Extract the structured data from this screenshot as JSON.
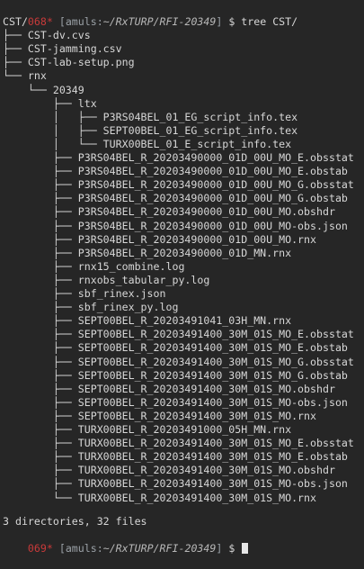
{
  "colors": {
    "background": "#262626",
    "text": "#d7d7d7",
    "prompt_red": "#c83a3a",
    "prompt_gray": "#9aa0a6"
  },
  "command_prompt": {
    "exit_code": "0",
    "counter": "68*",
    "user_host": "amuls",
    "path": "~/RxTURP/RFI-20349",
    "symbol": "$",
    "command": "tree CST/"
  },
  "tree_lines": [
    "CST/",
    "├── CST-dv.cvs",
    "├── CST-jamming.csv",
    "├── CST-lab-setup.png",
    "└── rnx",
    "    └── 20349",
    "        ├── ltx",
    "        │   ├── P3RS04BEL_01_EG_script_info.tex",
    "        │   ├── SEPT00BEL_01_EG_script_info.tex",
    "        │   └── TURX00BEL_01_E_script_info.tex",
    "        ├── P3RS04BEL_R_20203490000_01D_00U_MO_E.obsstat",
    "        ├── P3RS04BEL_R_20203490000_01D_00U_MO_E.obstab",
    "        ├── P3RS04BEL_R_20203490000_01D_00U_MO_G.obsstat",
    "        ├── P3RS04BEL_R_20203490000_01D_00U_MO_G.obstab",
    "        ├── P3RS04BEL_R_20203490000_01D_00U_MO.obshdr",
    "        ├── P3RS04BEL_R_20203490000_01D_00U_MO-obs.json",
    "        ├── P3RS04BEL_R_20203490000_01D_00U_MO.rnx",
    "        ├── P3RS04BEL_R_20203490000_01D_MN.rnx",
    "        ├── rnx15_combine.log",
    "        ├── rnxobs_tabular_py.log",
    "        ├── sbf_rinex.json",
    "        ├── sbf_rinex_py.log",
    "        ├── SEPT00BEL_R_20203491041_03H_MN.rnx",
    "        ├── SEPT00BEL_R_20203491400_30M_01S_MO_E.obsstat",
    "        ├── SEPT00BEL_R_20203491400_30M_01S_MO_E.obstab",
    "        ├── SEPT00BEL_R_20203491400_30M_01S_MO_G.obsstat",
    "        ├── SEPT00BEL_R_20203491400_30M_01S_MO_G.obstab",
    "        ├── SEPT00BEL_R_20203491400_30M_01S_MO.obshdr",
    "        ├── SEPT00BEL_R_20203491400_30M_01S_MO-obs.json",
    "        ├── SEPT00BEL_R_20203491400_30M_01S_MO.rnx",
    "        ├── TURX00BEL_R_20203491000_05H_MN.rnx",
    "        ├── TURX00BEL_R_20203491400_30M_01S_MO_E.obsstat",
    "        ├── TURX00BEL_R_20203491400_30M_01S_MO_E.obstab",
    "        ├── TURX00BEL_R_20203491400_30M_01S_MO.obshdr",
    "        ├── TURX00BEL_R_20203491400_30M_01S_MO-obs.json",
    "        └── TURX00BEL_R_20203491400_30M_01S_MO.rnx"
  ],
  "blank_line": "",
  "summary": "3 directories, 32 files",
  "next_prompt": {
    "exit_code": "0",
    "counter": "69*",
    "user_host": "amuls",
    "path": "~/RxTURP/RFI-20349",
    "symbol": "$"
  }
}
